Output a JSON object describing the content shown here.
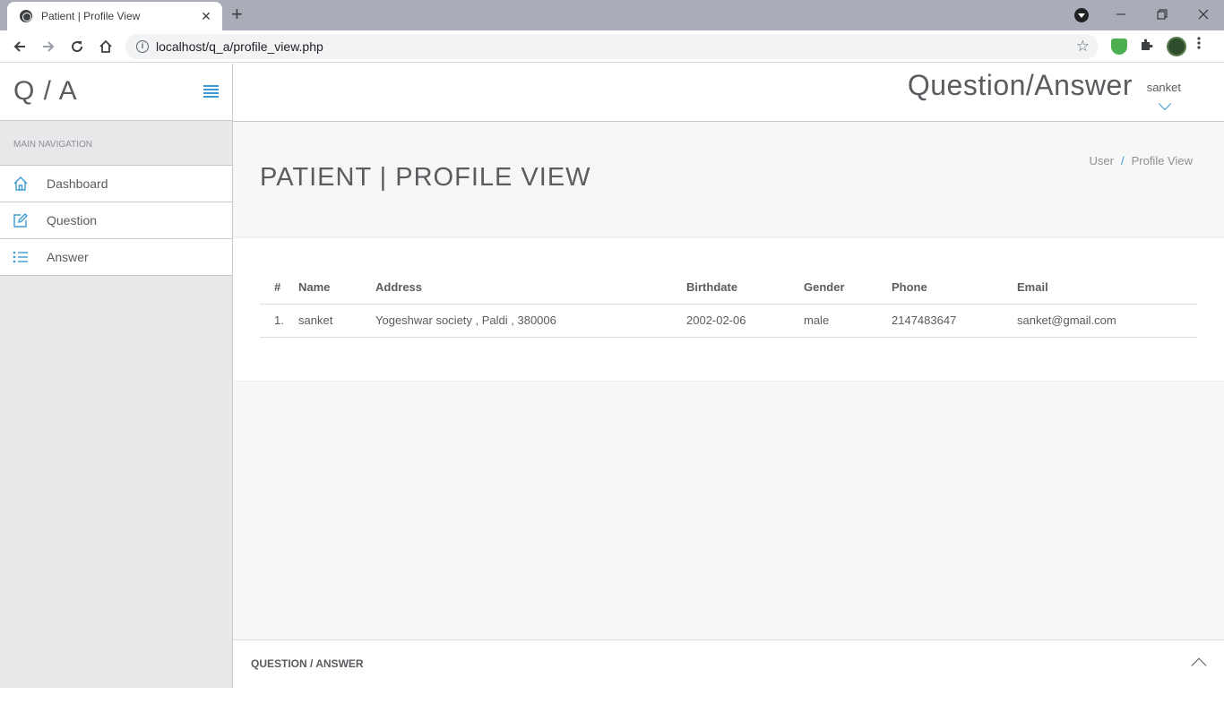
{
  "browser": {
    "tab_title": "Patient | Profile View",
    "close_glyph": "✕",
    "newtab_glyph": "+",
    "url": "localhost/q_a/profile_view.php"
  },
  "sidebar": {
    "logo": "Q / A",
    "nav_heading": "MAIN NAVIGATION",
    "items": [
      {
        "label": "Dashboard",
        "icon": "home-icon"
      },
      {
        "label": "Question",
        "icon": "edit-icon"
      },
      {
        "label": "Answer",
        "icon": "list-icon"
      }
    ]
  },
  "topbar": {
    "app_title": "Question/Answer",
    "username": "sanket"
  },
  "page": {
    "title": "PATIENT | PROFILE VIEW",
    "breadcrumb": [
      "User",
      "Profile View"
    ],
    "table": {
      "headers": [
        "#",
        "Name",
        "Address",
        "Birthdate",
        "Gender",
        "Phone",
        "Email"
      ],
      "rows": [
        [
          "1.",
          "sanket",
          "Yogeshwar society , Paldi , 380006",
          "2002-02-06",
          "male",
          "2147483647",
          "sanket@gmail.com"
        ]
      ]
    }
  },
  "footer": {
    "text": "QUESTION / ANSWER"
  },
  "colors": {
    "accent": "#3d9ad1",
    "text": "#5b5b60",
    "sidebar_bg": "#e8e8eb"
  }
}
